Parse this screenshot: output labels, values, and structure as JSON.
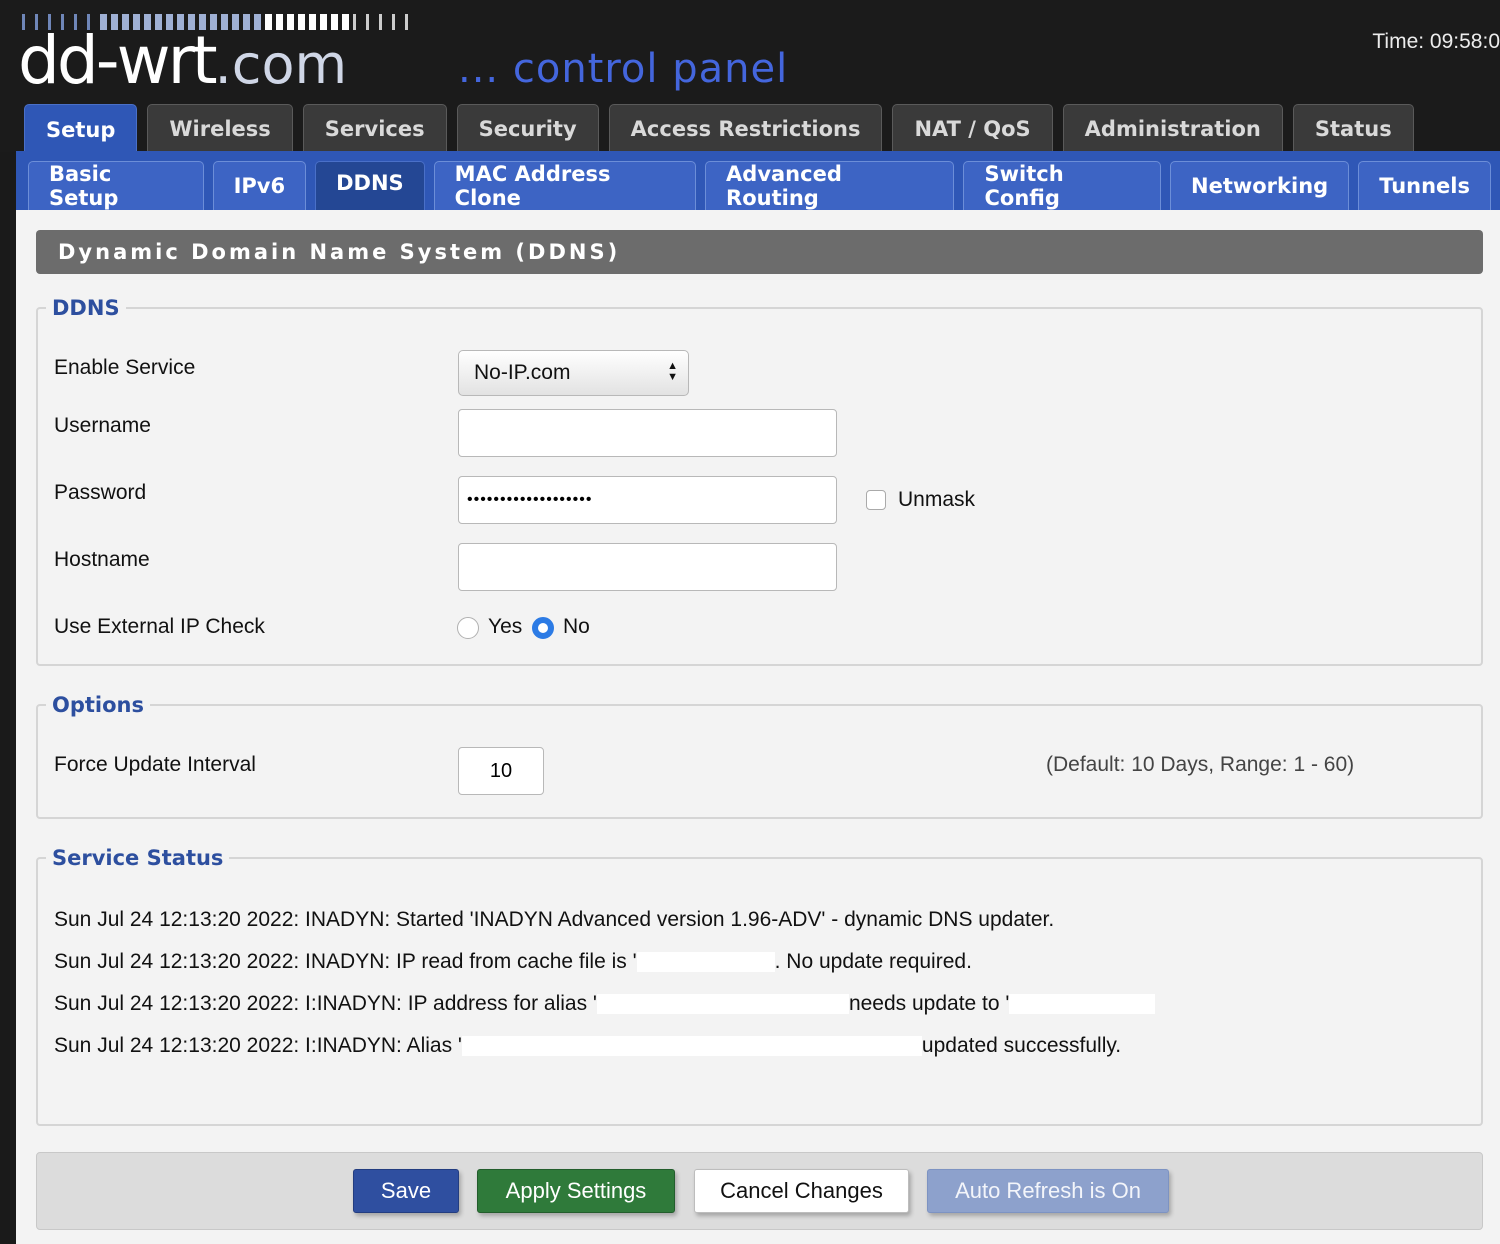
{
  "header": {
    "logo_text": "dd-wrt",
    "logo_suffix": ".com",
    "logo_subtitle": "... control panel",
    "clock": "Time: 09:58:0"
  },
  "main_tabs": [
    "Setup",
    "Wireless",
    "Services",
    "Security",
    "Access Restrictions",
    "NAT / QoS",
    "Administration",
    "Status"
  ],
  "active_main_tab": "Setup",
  "sub_tabs": [
    "Basic Setup",
    "IPv6",
    "DDNS",
    "MAC Address Clone",
    "Advanced Routing",
    "Switch Config",
    "Networking",
    "Tunnels"
  ],
  "active_sub_tab": "DDNS",
  "page_title": "Dynamic Domain Name System (DDNS)",
  "ddns": {
    "legend": "DDNS",
    "enable_service_label": "Enable Service",
    "enable_service_value": "No-IP.com",
    "username_label": "Username",
    "username_value": "",
    "password_label": "Password",
    "password_value": "•••••••••••••••••••",
    "unmask_label": "Unmask",
    "hostname_label": "Hostname",
    "hostname_value": "",
    "external_ip_label": "Use External IP Check",
    "yes_label": "Yes",
    "no_label": "No",
    "external_ip_selected": "No"
  },
  "options": {
    "legend": "Options",
    "force_update_label": "Force Update Interval",
    "force_update_value": "10",
    "force_update_hint": "(Default: 10 Days, Range: 1 - 60)"
  },
  "service_status": {
    "legend": "Service Status",
    "lines": [
      {
        "a": "Sun Jul 24 12:13:20 2022: INADYN: Started 'INADYN Advanced version 1.96-ADV' - dynamic DNS updater."
      },
      {
        "a": "Sun Jul 24 12:13:20 2022: INADYN: IP read from cache file is '",
        "b": ". No update required."
      },
      {
        "a": "Sun Jul 24 12:13:20 2022: I:INADYN: IP address for alias '",
        "b": "needs update to '"
      },
      {
        "a": "Sun Jul 24 12:13:20 2022: I:INADYN: Alias '",
        "b": "updated successfully."
      }
    ]
  },
  "buttons": {
    "save": "Save",
    "apply": "Apply Settings",
    "cancel": "Cancel Changes",
    "refresh": "Auto Refresh is On"
  },
  "colors": {
    "accent_blue": "#2f57b6",
    "save": "#2f4fa0",
    "apply": "#2f7a3a",
    "refresh": "#8da1cc"
  }
}
